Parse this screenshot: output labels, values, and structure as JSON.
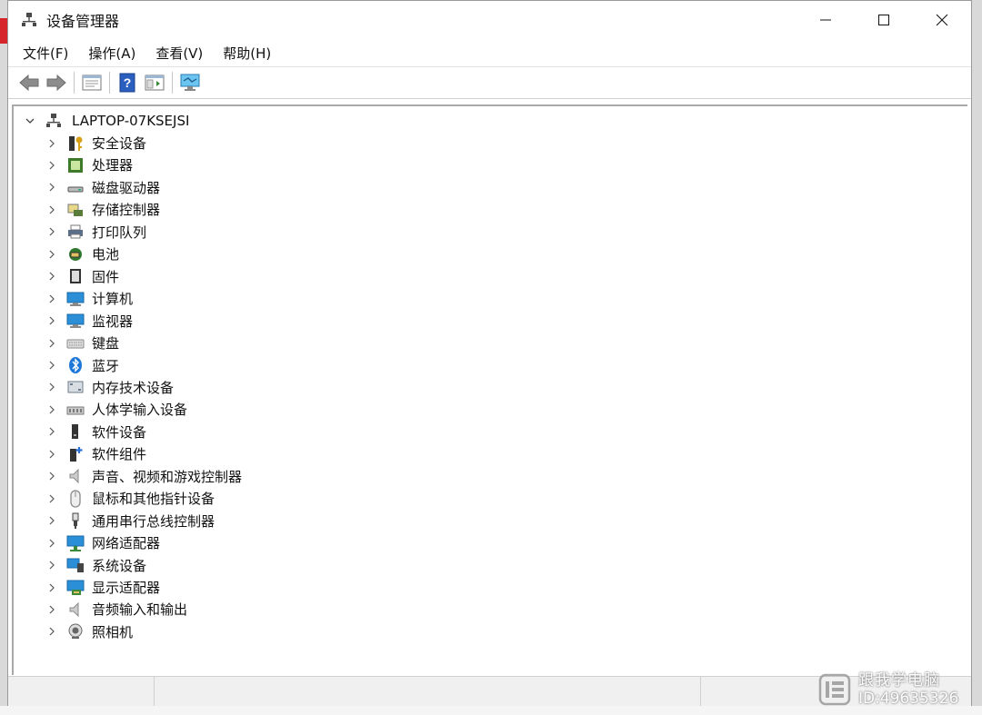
{
  "window": {
    "title": "设备管理器",
    "minimize_glyph": "—",
    "maximize_glyph": "☐",
    "close_glyph": "✕"
  },
  "menu": {
    "items": [
      {
        "label": "文件(F)",
        "name": "menu-file"
      },
      {
        "label": "操作(A)",
        "name": "menu-action"
      },
      {
        "label": "查看(V)",
        "name": "menu-view"
      },
      {
        "label": "帮助(H)",
        "name": "menu-help"
      }
    ]
  },
  "toolbar": {
    "buttons": [
      {
        "name": "back-button",
        "icon": "arrow-left-icon"
      },
      {
        "name": "forward-button",
        "icon": "arrow-right-icon"
      },
      {
        "name": "properties-button",
        "icon": "properties-icon"
      },
      {
        "name": "help-button",
        "icon": "help-icon"
      },
      {
        "name": "show-hide-tree-button",
        "icon": "tree-view-icon"
      },
      {
        "name": "scan-hardware-button",
        "icon": "monitor-scan-icon"
      }
    ]
  },
  "tree": {
    "root_label": "LAPTOP-07KSEJSI",
    "items": [
      {
        "label": "安全设备",
        "icon": "security-key-icon",
        "color": "#d9a11a"
      },
      {
        "label": "处理器",
        "icon": "cpu-icon",
        "color": "#3d7a2a"
      },
      {
        "label": "磁盘驱动器",
        "icon": "disk-drive-icon",
        "color": "#555555"
      },
      {
        "label": "存储控制器",
        "icon": "storage-controller-icon",
        "color": "#5a7c3a"
      },
      {
        "label": "打印队列",
        "icon": "printer-icon",
        "color": "#5a6f87"
      },
      {
        "label": "电池",
        "icon": "battery-icon",
        "color": "#2f7a2f"
      },
      {
        "label": "固件",
        "icon": "firmware-icon",
        "color": "#333333"
      },
      {
        "label": "计算机",
        "icon": "computer-icon",
        "color": "#2a8fd6"
      },
      {
        "label": "监视器",
        "icon": "monitor-icon",
        "color": "#2a8fd6"
      },
      {
        "label": "键盘",
        "icon": "keyboard-icon",
        "color": "#8a8a8a"
      },
      {
        "label": "蓝牙",
        "icon": "bluetooth-icon",
        "color": "#1e78d7"
      },
      {
        "label": "内存技术设备",
        "icon": "memory-card-icon",
        "color": "#6d7b8a"
      },
      {
        "label": "人体学输入设备",
        "icon": "hid-icon",
        "color": "#7a7a7a"
      },
      {
        "label": "软件设备",
        "icon": "software-device-icon",
        "color": "#333333"
      },
      {
        "label": "软件组件",
        "icon": "software-component-icon",
        "color": "#2a6fd6"
      },
      {
        "label": "声音、视频和游戏控制器",
        "icon": "speaker-icon",
        "color": "#8a8a8a"
      },
      {
        "label": "鼠标和其他指针设备",
        "icon": "mouse-icon",
        "color": "#8a8a8a"
      },
      {
        "label": "通用串行总线控制器",
        "icon": "usb-icon",
        "color": "#444444"
      },
      {
        "label": "网络适配器",
        "icon": "network-adapter-icon",
        "color": "#2a8fd6"
      },
      {
        "label": "系统设备",
        "icon": "system-device-icon",
        "color": "#2a8fd6"
      },
      {
        "label": "显示适配器",
        "icon": "display-adapter-icon",
        "color": "#2a8fd6"
      },
      {
        "label": "音频输入和输出",
        "icon": "audio-io-icon",
        "color": "#8a8a8a"
      },
      {
        "label": "照相机",
        "icon": "camera-icon",
        "color": "#666666"
      }
    ]
  },
  "watermark": {
    "line1": "跟我学电脑",
    "line2": "ID:49635326"
  },
  "colors": {
    "accent_blue": "#2a8fd6",
    "titlebar_bg": "#ffffff",
    "statusbar_bg": "#f0f0f0"
  }
}
